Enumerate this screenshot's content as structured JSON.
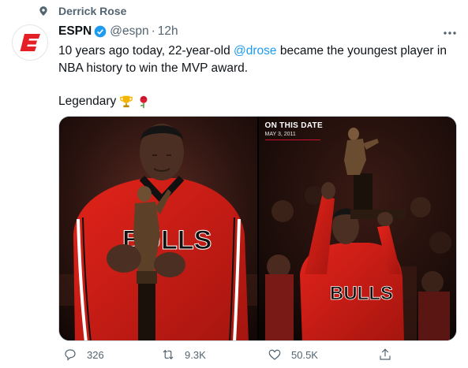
{
  "context": {
    "pinned_by": "Derrick Rose"
  },
  "tweet": {
    "author_name": "ESPN",
    "handle": "@espn",
    "separator": "·",
    "time": "12h",
    "text_before": "10 years ago today, 22-year-old ",
    "mention": "@drose",
    "text_after": " became the youngest player in NBA history to win the MVP award.",
    "second_line": "Legendary"
  },
  "media": {
    "right_title": "ON THIS DATE",
    "right_date": "MAY 3, 2011",
    "jersey_text": "BULLS"
  },
  "actions": {
    "replies": "326",
    "retweets": "9.3K",
    "likes": "50.5K"
  },
  "colors": {
    "accent": "#1d9bf0",
    "espn_red": "#e41f26",
    "bulls_red": "#c8102e"
  }
}
